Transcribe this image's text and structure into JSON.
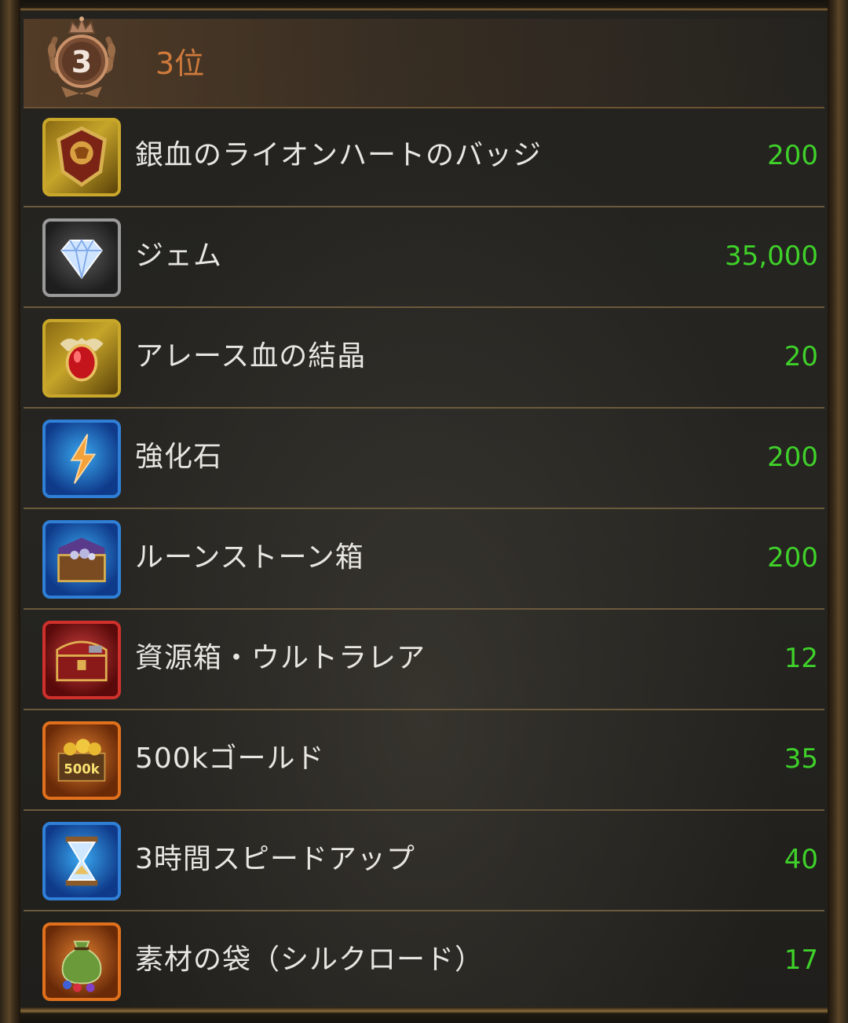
{
  "header": {
    "rank_number": "3",
    "rank_label": "3位"
  },
  "rewards": [
    {
      "name": "銀血のライオンハートのバッジ",
      "qty": "200",
      "icon": "lion-badge-icon"
    },
    {
      "name": "ジェム",
      "qty": "35,000",
      "icon": "gem-icon"
    },
    {
      "name": "アレース血の結晶",
      "qty": "20",
      "icon": "blood-crystal-icon"
    },
    {
      "name": "強化石",
      "qty": "200",
      "icon": "enhancement-stone-icon"
    },
    {
      "name": "ルーンストーン箱",
      "qty": "200",
      "icon": "runestone-chest-icon"
    },
    {
      "name": "資源箱・ウルトラレア",
      "qty": "12",
      "icon": "resource-chest-icon"
    },
    {
      "name": "500kゴールド",
      "qty": "35",
      "icon": "gold-icon",
      "icon_text": "500k"
    },
    {
      "name": "3時間スピードアップ",
      "qty": "40",
      "icon": "hourglass-icon"
    },
    {
      "name": "素材の袋（シルクロード）",
      "qty": "17",
      "icon": "material-bag-icon"
    }
  ],
  "colors": {
    "rank_text": "#d07a3c",
    "quantity": "#3fd12a",
    "label": "#e8e6e1",
    "divider": "#6b5a3c"
  }
}
